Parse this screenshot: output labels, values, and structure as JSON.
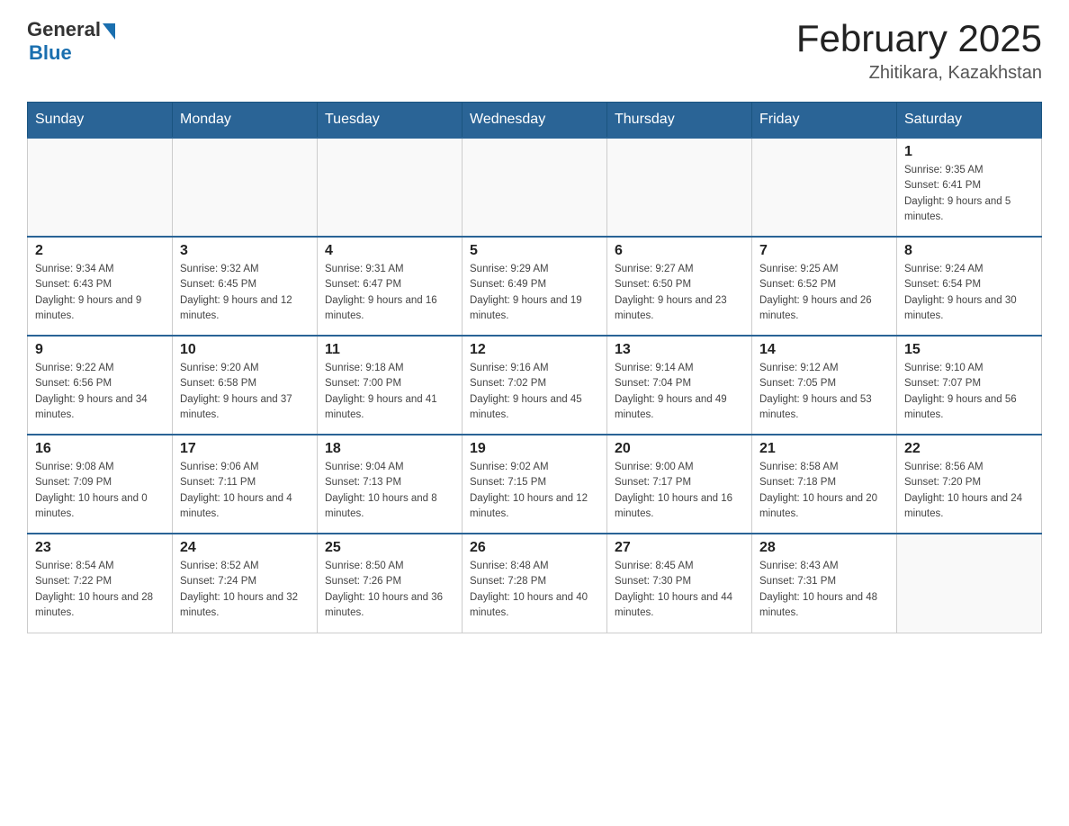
{
  "header": {
    "logo_general": "General",
    "logo_blue": "Blue",
    "title": "February 2025",
    "location": "Zhitikara, Kazakhstan"
  },
  "weekdays": [
    "Sunday",
    "Monday",
    "Tuesday",
    "Wednesday",
    "Thursday",
    "Friday",
    "Saturday"
  ],
  "weeks": [
    [
      {
        "day": "",
        "info": ""
      },
      {
        "day": "",
        "info": ""
      },
      {
        "day": "",
        "info": ""
      },
      {
        "day": "",
        "info": ""
      },
      {
        "day": "",
        "info": ""
      },
      {
        "day": "",
        "info": ""
      },
      {
        "day": "1",
        "info": "Sunrise: 9:35 AM\nSunset: 6:41 PM\nDaylight: 9 hours and 5 minutes."
      }
    ],
    [
      {
        "day": "2",
        "info": "Sunrise: 9:34 AM\nSunset: 6:43 PM\nDaylight: 9 hours and 9 minutes."
      },
      {
        "day": "3",
        "info": "Sunrise: 9:32 AM\nSunset: 6:45 PM\nDaylight: 9 hours and 12 minutes."
      },
      {
        "day": "4",
        "info": "Sunrise: 9:31 AM\nSunset: 6:47 PM\nDaylight: 9 hours and 16 minutes."
      },
      {
        "day": "5",
        "info": "Sunrise: 9:29 AM\nSunset: 6:49 PM\nDaylight: 9 hours and 19 minutes."
      },
      {
        "day": "6",
        "info": "Sunrise: 9:27 AM\nSunset: 6:50 PM\nDaylight: 9 hours and 23 minutes."
      },
      {
        "day": "7",
        "info": "Sunrise: 9:25 AM\nSunset: 6:52 PM\nDaylight: 9 hours and 26 minutes."
      },
      {
        "day": "8",
        "info": "Sunrise: 9:24 AM\nSunset: 6:54 PM\nDaylight: 9 hours and 30 minutes."
      }
    ],
    [
      {
        "day": "9",
        "info": "Sunrise: 9:22 AM\nSunset: 6:56 PM\nDaylight: 9 hours and 34 minutes."
      },
      {
        "day": "10",
        "info": "Sunrise: 9:20 AM\nSunset: 6:58 PM\nDaylight: 9 hours and 37 minutes."
      },
      {
        "day": "11",
        "info": "Sunrise: 9:18 AM\nSunset: 7:00 PM\nDaylight: 9 hours and 41 minutes."
      },
      {
        "day": "12",
        "info": "Sunrise: 9:16 AM\nSunset: 7:02 PM\nDaylight: 9 hours and 45 minutes."
      },
      {
        "day": "13",
        "info": "Sunrise: 9:14 AM\nSunset: 7:04 PM\nDaylight: 9 hours and 49 minutes."
      },
      {
        "day": "14",
        "info": "Sunrise: 9:12 AM\nSunset: 7:05 PM\nDaylight: 9 hours and 53 minutes."
      },
      {
        "day": "15",
        "info": "Sunrise: 9:10 AM\nSunset: 7:07 PM\nDaylight: 9 hours and 56 minutes."
      }
    ],
    [
      {
        "day": "16",
        "info": "Sunrise: 9:08 AM\nSunset: 7:09 PM\nDaylight: 10 hours and 0 minutes."
      },
      {
        "day": "17",
        "info": "Sunrise: 9:06 AM\nSunset: 7:11 PM\nDaylight: 10 hours and 4 minutes."
      },
      {
        "day": "18",
        "info": "Sunrise: 9:04 AM\nSunset: 7:13 PM\nDaylight: 10 hours and 8 minutes."
      },
      {
        "day": "19",
        "info": "Sunrise: 9:02 AM\nSunset: 7:15 PM\nDaylight: 10 hours and 12 minutes."
      },
      {
        "day": "20",
        "info": "Sunrise: 9:00 AM\nSunset: 7:17 PM\nDaylight: 10 hours and 16 minutes."
      },
      {
        "day": "21",
        "info": "Sunrise: 8:58 AM\nSunset: 7:18 PM\nDaylight: 10 hours and 20 minutes."
      },
      {
        "day": "22",
        "info": "Sunrise: 8:56 AM\nSunset: 7:20 PM\nDaylight: 10 hours and 24 minutes."
      }
    ],
    [
      {
        "day": "23",
        "info": "Sunrise: 8:54 AM\nSunset: 7:22 PM\nDaylight: 10 hours and 28 minutes."
      },
      {
        "day": "24",
        "info": "Sunrise: 8:52 AM\nSunset: 7:24 PM\nDaylight: 10 hours and 32 minutes."
      },
      {
        "day": "25",
        "info": "Sunrise: 8:50 AM\nSunset: 7:26 PM\nDaylight: 10 hours and 36 minutes."
      },
      {
        "day": "26",
        "info": "Sunrise: 8:48 AM\nSunset: 7:28 PM\nDaylight: 10 hours and 40 minutes."
      },
      {
        "day": "27",
        "info": "Sunrise: 8:45 AM\nSunset: 7:30 PM\nDaylight: 10 hours and 44 minutes."
      },
      {
        "day": "28",
        "info": "Sunrise: 8:43 AM\nSunset: 7:31 PM\nDaylight: 10 hours and 48 minutes."
      },
      {
        "day": "",
        "info": ""
      }
    ]
  ]
}
